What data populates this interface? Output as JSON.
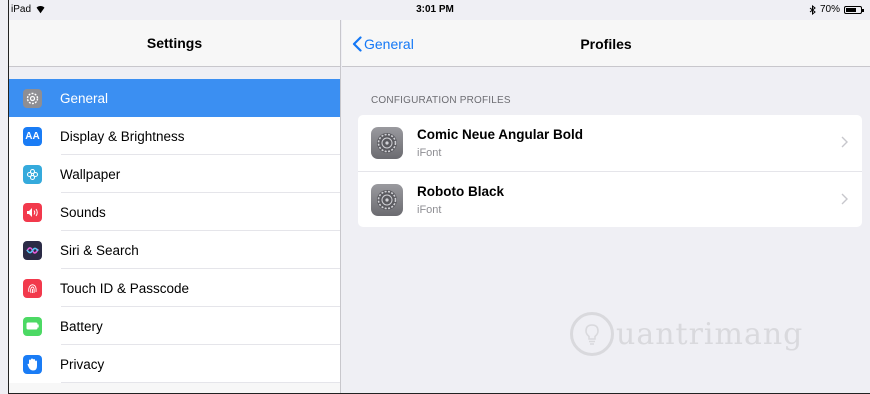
{
  "status_bar": {
    "device": "iPad",
    "time": "3:01 PM",
    "battery": "70%"
  },
  "left": {
    "title": "Settings",
    "items": [
      {
        "label": "General",
        "icon": "gear-icon",
        "color": "#8e8e93",
        "active": true
      },
      {
        "label": "Display & Brightness",
        "icon": "text-size-icon",
        "color": "#1a7cf5",
        "glyph": "AA"
      },
      {
        "label": "Wallpaper",
        "icon": "flower-icon",
        "color": "#35aadc"
      },
      {
        "label": "Sounds",
        "icon": "speaker-icon",
        "color": "#f2394c"
      },
      {
        "label": "Siri & Search",
        "icon": "siri-icon",
        "color": "#2b2b46"
      },
      {
        "label": "Touch ID & Passcode",
        "icon": "fingerprint-icon",
        "color": "#f2394c"
      },
      {
        "label": "Battery",
        "icon": "battery-icon",
        "color": "#4cd964"
      },
      {
        "label": "Privacy",
        "icon": "hand-icon",
        "color": "#1a7cf5"
      }
    ]
  },
  "right": {
    "back_label": "General",
    "title": "Profiles",
    "section_header": "CONFIGURATION PROFILES",
    "profiles": [
      {
        "name": "Comic Neue Angular Bold",
        "source": "iFont"
      },
      {
        "name": "Roboto Black",
        "source": "iFont"
      }
    ]
  },
  "watermark": "uantrimang"
}
